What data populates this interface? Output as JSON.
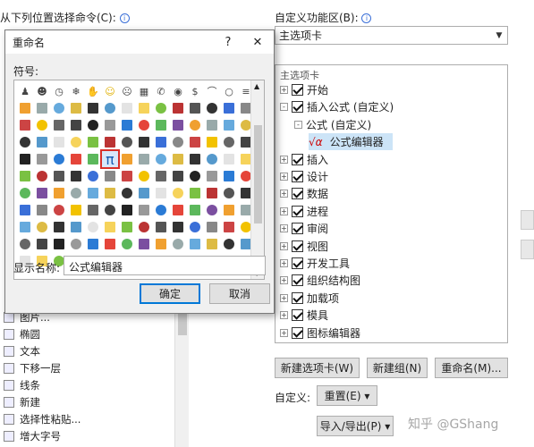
{
  "left_panel": {
    "title": "从下列位置选择命令(C):",
    "title_info_icon": "info-icon",
    "items": [
      "图片...",
      "椭圆",
      "文本",
      "下移一层",
      "线条",
      "新建",
      "选择性粘贴...",
      "增大字号"
    ]
  },
  "right_panel": {
    "title": "自定义功能区(B):",
    "title_info_icon": "info-icon",
    "dropdown_value": "主选项卡",
    "tree_header": "主选项卡",
    "tree": [
      {
        "label": "开始",
        "level": 0,
        "expander": "+",
        "checked": true
      },
      {
        "label": "插入公式 (自定义)",
        "level": 0,
        "expander": "-",
        "checked": true
      },
      {
        "label": "公式 (自定义)",
        "level": 1,
        "expander": "-",
        "checked": false
      },
      {
        "label": "公式编辑器",
        "level": 2,
        "expander": "",
        "checked": false,
        "selected": true
      },
      {
        "label": "插入",
        "level": 0,
        "expander": "+",
        "checked": true
      },
      {
        "label": "设计",
        "level": 0,
        "expander": "+",
        "checked": true
      },
      {
        "label": "数据",
        "level": 0,
        "expander": "+",
        "checked": true
      },
      {
        "label": "进程",
        "level": 0,
        "expander": "+",
        "checked": true
      },
      {
        "label": "审阅",
        "level": 0,
        "expander": "+",
        "checked": true
      },
      {
        "label": "视图",
        "level": 0,
        "expander": "+",
        "checked": true
      },
      {
        "label": "开发工具",
        "level": 0,
        "expander": "+",
        "checked": true
      },
      {
        "label": "组织结构图",
        "level": 0,
        "expander": "+",
        "checked": true
      },
      {
        "label": "加载项",
        "level": 0,
        "expander": "+",
        "checked": true
      },
      {
        "label": "模具",
        "level": 0,
        "expander": "+",
        "checked": true
      },
      {
        "label": "图标编辑器",
        "level": 0,
        "expander": "+",
        "checked": true
      }
    ],
    "buttons": {
      "new_tab": "新建选项卡(W)",
      "new_group": "新建组(N)",
      "rename": "重命名(M)..."
    },
    "customize_label": "自定义:",
    "reset": "重置(E) ▾",
    "import_export": "导入/导出(P) ▾",
    "watermark": "知乎 @GShang"
  },
  "dialog": {
    "title": "重命名",
    "help": "?",
    "close": "✕",
    "symbol_label": "符号:",
    "display_name_label": "显示名称:",
    "display_name_value": "公式编辑器",
    "ok": "确定",
    "cancel": "取消"
  },
  "symbol_colors": [
    "#555",
    "#333",
    "#3a6fd8",
    "#888",
    "#c44",
    "#f2c200",
    "#666",
    "#444",
    "#222",
    "#999",
    "#2b7bd5",
    "#e5453a",
    "#5cb85c",
    "#7b4fa0",
    "#f0a030",
    "#9aa",
    "#6ad",
    "#db4",
    "#333",
    "#59c",
    "#e3e3e3",
    "#f6d35b",
    "#7ac143",
    "#b33"
  ]
}
